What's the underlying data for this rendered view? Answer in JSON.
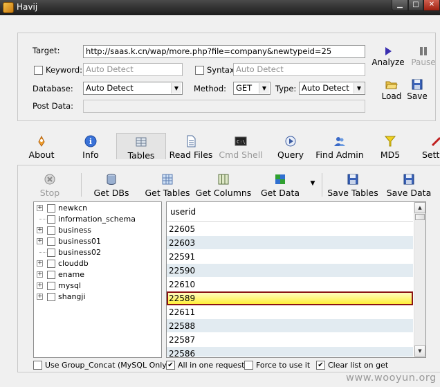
{
  "window": {
    "title": "Havij"
  },
  "target_form": {
    "target_label": "Target:",
    "target_value": "http://saas.k.cn/wap/more.php?file=company&newtypeid=25",
    "keyword_label": "Keyword:",
    "keyword_placeholder": "Auto Detect",
    "syntax_label": "Syntax:",
    "syntax_placeholder": "Auto Detect",
    "database_label": "Database:",
    "database_value": "Auto Detect",
    "method_label": "Method:",
    "method_value": "GET",
    "type_label": "Type:",
    "type_value": "Auto Detect",
    "postdata_label": "Post Data:"
  },
  "side_buttons": {
    "analyze": "Analyze",
    "pause": "Pause",
    "load": "Load",
    "save": "Save"
  },
  "toolbar": {
    "items": [
      "About",
      "Info",
      "Tables",
      "Read Files",
      "Cmd Shell",
      "Query",
      "Find Admin",
      "MD5",
      "Setti"
    ],
    "active": "Tables"
  },
  "panel_toolbar": {
    "stop": "Stop",
    "get_dbs": "Get DBs",
    "get_tables": "Get Tables",
    "get_columns": "Get Columns",
    "get_data": "Get Data",
    "save_tables": "Save Tables",
    "save_data": "Save Data"
  },
  "db_tree": [
    {
      "name": "newkcn",
      "expandable": true
    },
    {
      "name": "information_schema",
      "expandable": false
    },
    {
      "name": "business",
      "expandable": true
    },
    {
      "name": "business01",
      "expandable": true
    },
    {
      "name": "business02",
      "expandable": false
    },
    {
      "name": "clouddb",
      "expandable": true
    },
    {
      "name": "ename",
      "expandable": true
    },
    {
      "name": "mysql",
      "expandable": true
    },
    {
      "name": "shangji",
      "expandable": true
    }
  ],
  "grid": {
    "column": "userid",
    "rows": [
      "22605",
      "22603",
      "22591",
      "22590",
      "22610",
      "22589",
      "22611",
      "22588",
      "22587",
      "22586"
    ],
    "selected_row": "22589"
  },
  "options": {
    "group_concat": "Use Group_Concat (MySQL Only)",
    "group_concat_checked": false,
    "all_in_one": "All in one request.",
    "all_in_one_checked": true,
    "force": "Force to use it",
    "force_checked": false,
    "clear_list": "Clear list on get",
    "clear_list_checked": true
  },
  "watermark": "www.wooyun.org",
  "colors": {
    "selected_row": "#fff34a",
    "selected_border": "#8b1414",
    "alt_row": "#e2ebf1",
    "titlebar": "#2a2a2a"
  },
  "icons": {
    "analyze": "play-triangle-icon",
    "pause": "pause-icon",
    "load": "folder-open-icon",
    "save": "floppy-disk-icon"
  }
}
